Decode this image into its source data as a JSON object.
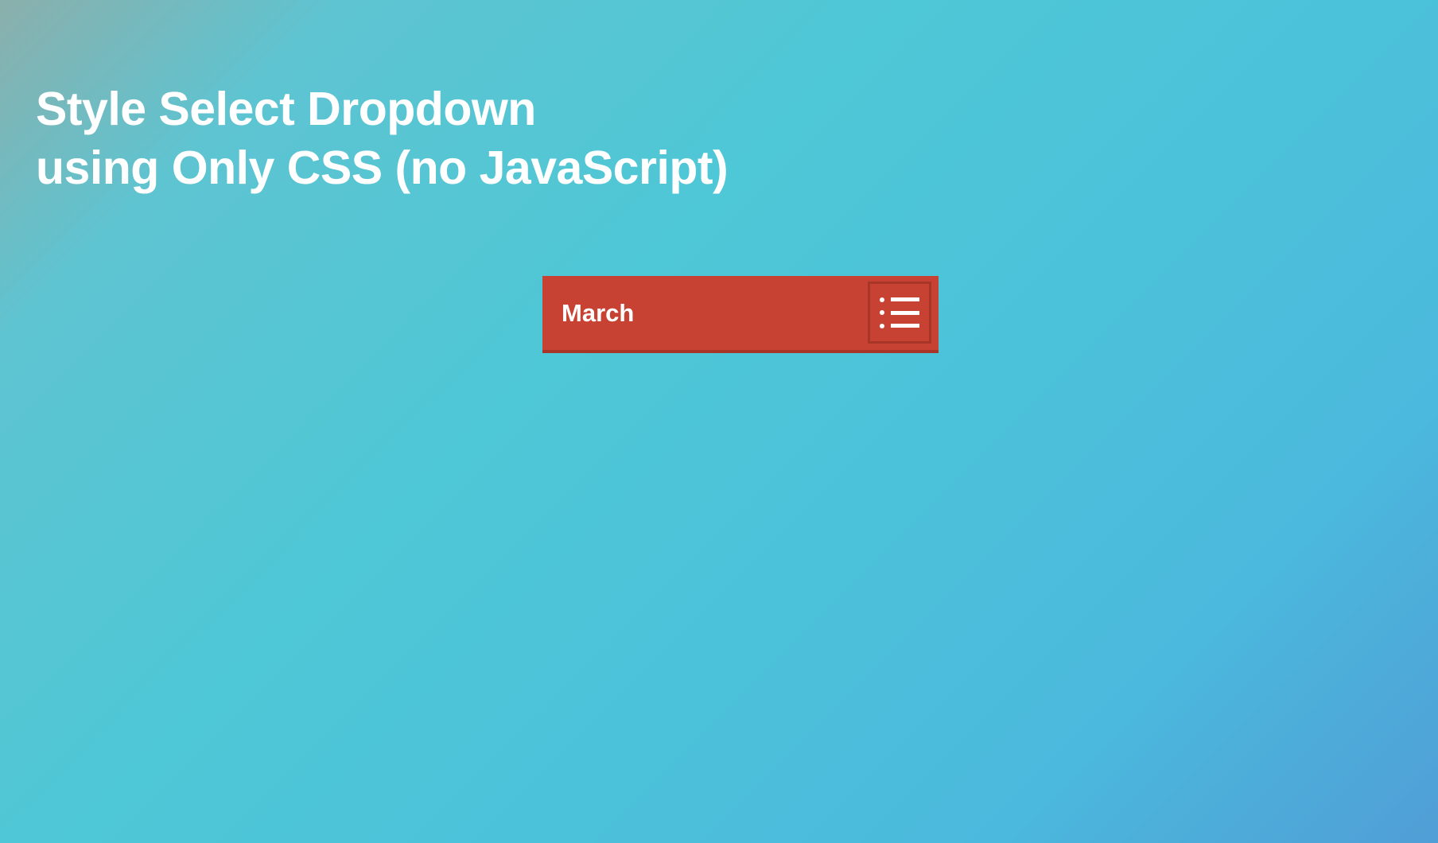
{
  "heading": {
    "text": "Style Select Dropdown\nusing Only CSS (no JavaScript)"
  },
  "select": {
    "selected_value": "March",
    "icon_name": "list-icon",
    "colors": {
      "background": "#c74232",
      "border_bottom": "#a83628",
      "text": "#ffffff"
    }
  }
}
